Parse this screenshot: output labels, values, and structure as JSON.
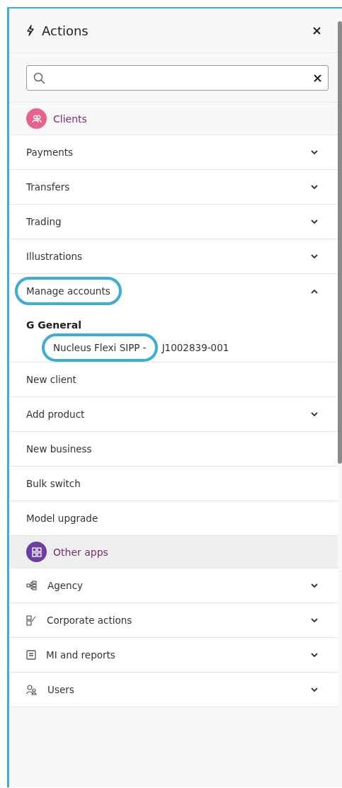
{
  "header": {
    "title": "Actions"
  },
  "sections": [
    {
      "title": "Clients",
      "color": "#e8638a",
      "items": [
        {
          "label": "Payments",
          "kind": "collapsible",
          "expanded": false
        },
        {
          "label": "Transfers",
          "kind": "collapsible",
          "expanded": false
        },
        {
          "label": "Trading",
          "kind": "collapsible",
          "expanded": false
        },
        {
          "label": "Illustrations",
          "kind": "collapsible",
          "expanded": false
        },
        {
          "label": "Manage accounts",
          "kind": "collapsible",
          "expanded": true,
          "highlighted": true,
          "children": [
            {
              "label": "G General",
              "children": [
                {
                  "label": "Nucleus Flexi SIPP -",
                  "code": "J1002839-001",
                  "highlighted": true
                }
              ]
            }
          ]
        },
        {
          "label": "New client",
          "kind": "link"
        },
        {
          "label": "Add product",
          "kind": "collapsible",
          "expanded": false
        },
        {
          "label": "New business",
          "kind": "link"
        },
        {
          "label": "Bulk switch",
          "kind": "link"
        },
        {
          "label": "Model upgrade",
          "kind": "link"
        }
      ]
    },
    {
      "title": "Other apps",
      "color": "#6b3fa0",
      "items": [
        {
          "label": "Agency",
          "kind": "collapsible",
          "expanded": false
        },
        {
          "label": "Corporate actions",
          "kind": "collapsible",
          "expanded": false
        },
        {
          "label": "MI and reports",
          "kind": "collapsible",
          "expanded": false
        },
        {
          "label": "Users",
          "kind": "collapsible",
          "expanded": false
        }
      ]
    }
  ]
}
